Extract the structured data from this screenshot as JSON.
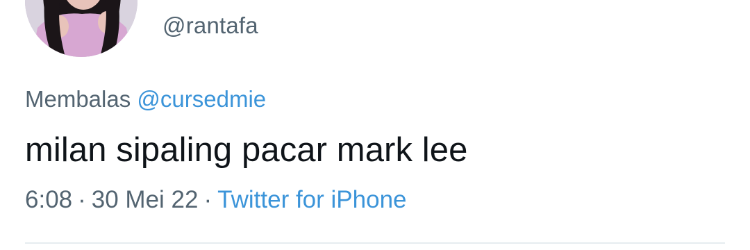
{
  "author": {
    "handle": "@rantafa",
    "avatar_icon": "profile-photo"
  },
  "reply": {
    "prefix": "Membalas",
    "target": "@cursedmie"
  },
  "tweet": {
    "text": "milan sipaling pacar mark lee"
  },
  "meta": {
    "time": "6:08",
    "separator": "·",
    "date": "30 Mei 22",
    "source": "Twitter for iPhone"
  },
  "colors": {
    "text_primary": "#0f1419",
    "text_secondary": "#536471",
    "link": "#3b94d9",
    "divider": "#e6ecf0"
  }
}
